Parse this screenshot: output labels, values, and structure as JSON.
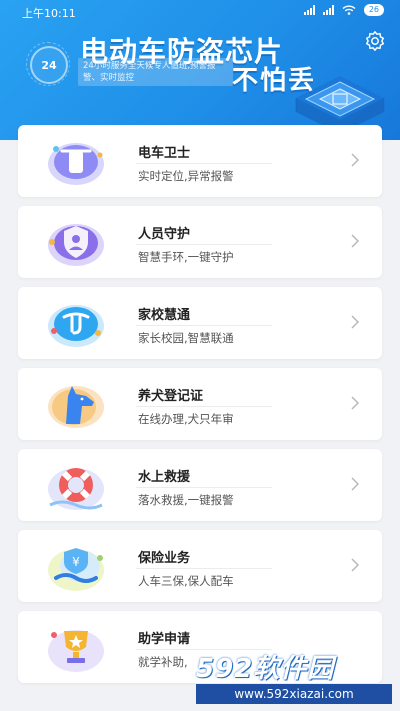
{
  "statusbar": {
    "time": "上午10:11",
    "battery": "26"
  },
  "banner": {
    "title_line1": "电动车防盗芯片",
    "title_line2": "不怕丢",
    "badge": "24",
    "subtitle": "24小时服务全天候专人值班,预警报警、实时监控"
  },
  "menu": [
    {
      "title": "电车卫士",
      "subtitle": "实时定位,异常报警",
      "icon": "scooter-icon",
      "color": "#8e8bf5"
    },
    {
      "title": "人员守护",
      "subtitle": "智慧手环,一键守护",
      "icon": "shield-person-icon",
      "color": "#8a6fe8"
    },
    {
      "title": "家校慧通",
      "subtitle": "家长校园,智慧联通",
      "icon": "school-connect-icon",
      "color": "#2fa6f0"
    },
    {
      "title": "养犬登记证",
      "subtitle": "在线办理,犬只年审",
      "icon": "dog-icon",
      "color": "#3a84f0"
    },
    {
      "title": "水上救援",
      "subtitle": "落水救援,一键报警",
      "icon": "lifebuoy-icon",
      "color": "#ef5d5d"
    },
    {
      "title": "保险业务",
      "subtitle": "人车三保,保人配车",
      "icon": "insurance-icon",
      "color": "#5ab3f5"
    },
    {
      "title": "助学申请",
      "subtitle": "就学补助,",
      "icon": "trophy-icon",
      "color": "#f5b531"
    }
  ],
  "watermark": {
    "brand": "592软件园",
    "url": "www.592xiazai.com"
  }
}
